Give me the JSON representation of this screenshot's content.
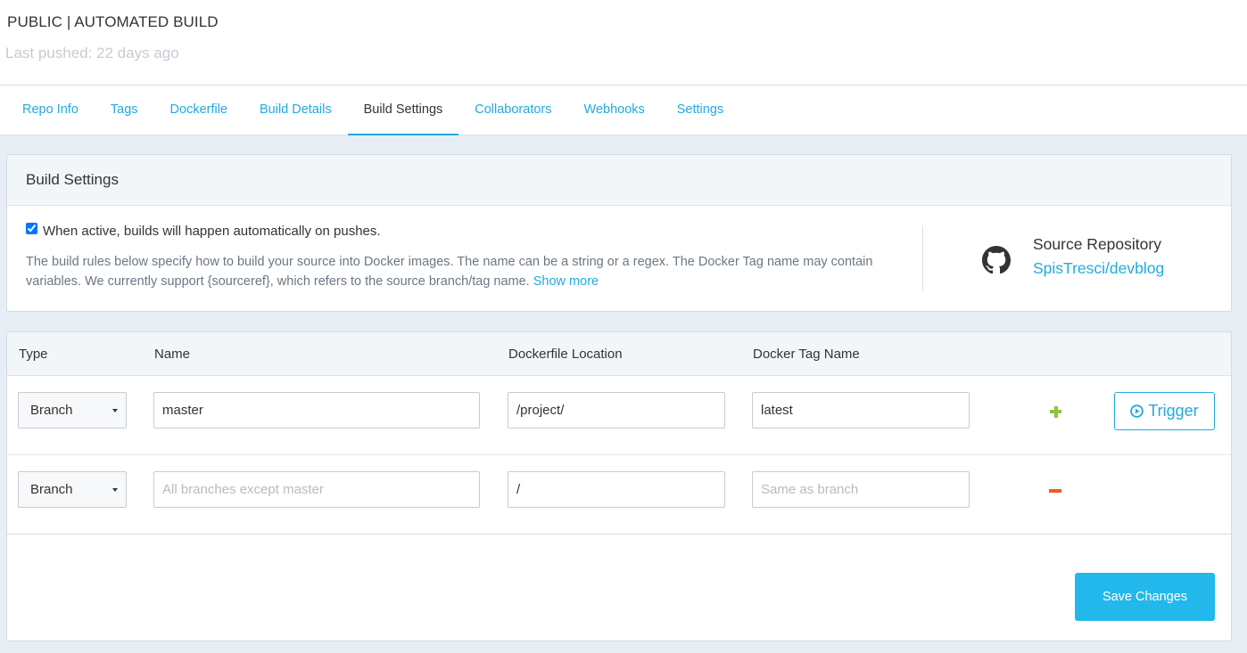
{
  "header": {
    "repo_meta": "PUBLIC | AUTOMATED BUILD",
    "last_pushed": "Last pushed: 22 days ago"
  },
  "tabs": [
    {
      "label": "Repo Info"
    },
    {
      "label": "Tags"
    },
    {
      "label": "Dockerfile"
    },
    {
      "label": "Build Details"
    },
    {
      "label": "Build Settings",
      "active": true
    },
    {
      "label": "Collaborators"
    },
    {
      "label": "Webhooks"
    },
    {
      "label": "Settings"
    }
  ],
  "build_settings": {
    "title": "Build Settings",
    "auto_build_label": "When active, builds will happen automatically on pushes.",
    "auto_build_checked": true,
    "description": "The build rules below specify how to build your source into Docker images. The name can be a string or a regex. The Docker Tag name may contain variables. We currently support {sourceref}, which refers to the source branch/tag name.",
    "show_more": "Show more",
    "source_repo_label": "Source Repository",
    "source_repo_link": "SpisTresci/devblog",
    "source_icon": "github-icon"
  },
  "table": {
    "headers": [
      "Type",
      "Name",
      "Dockerfile Location",
      "Docker Tag Name"
    ],
    "rows": [
      {
        "type": "Branch",
        "name": "master",
        "name_placeholder": "",
        "location": "/project/",
        "tag": "latest",
        "tag_placeholder": "",
        "action": "add"
      },
      {
        "type": "Branch",
        "name": "",
        "name_placeholder": "All branches except master",
        "location": "/",
        "tag": "",
        "tag_placeholder": "Same as branch",
        "action": "remove"
      }
    ],
    "trigger_label": "Trigger"
  },
  "save_label": "Save Changes",
  "colors": {
    "accent": "#22aadd",
    "add": "#8cc63f",
    "remove": "#f05a22",
    "save_bg": "#22b8eb"
  }
}
